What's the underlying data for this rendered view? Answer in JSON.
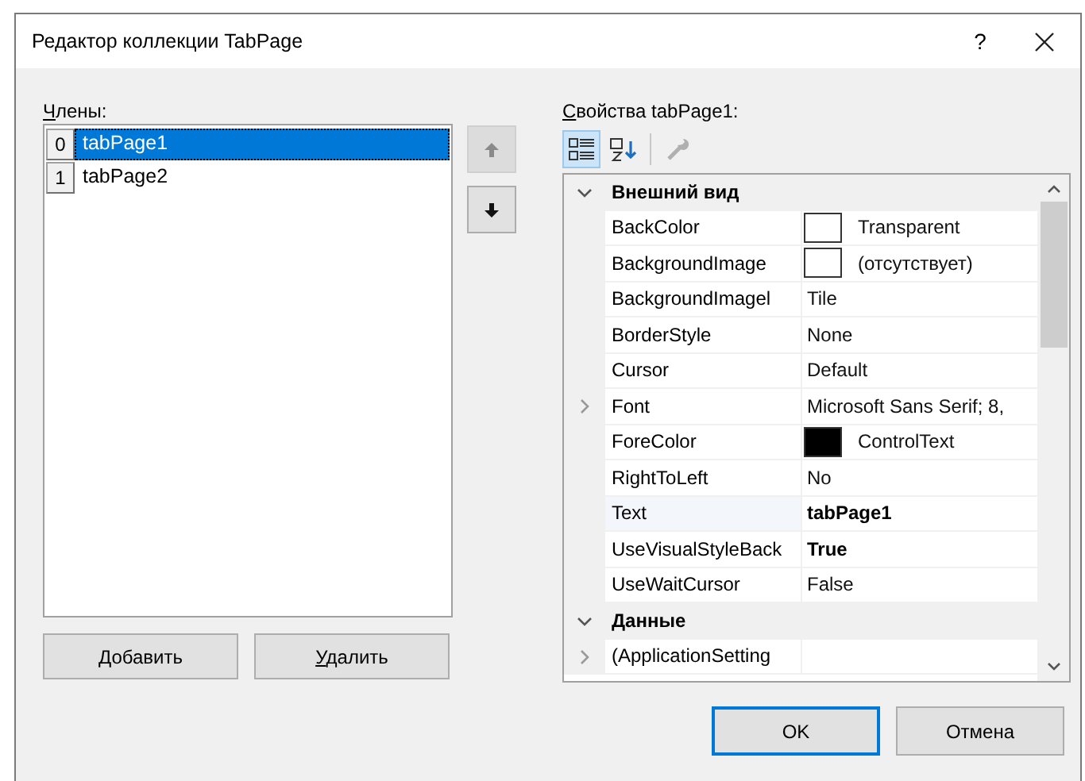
{
  "window": {
    "title": "Редактор коллекции TabPage",
    "help": "?"
  },
  "members": {
    "label": "Члены:",
    "items": [
      {
        "index": "0",
        "name": "tabPage1",
        "selected": true
      },
      {
        "index": "1",
        "name": "tabPage2",
        "selected": false
      }
    ]
  },
  "buttons_left": [
    "Добавить",
    "Удалить"
  ],
  "properties": {
    "label": "Свойства tabPage1:",
    "toolbar": [
      {
        "kind": "categorized",
        "selected": true,
        "disabled": false
      },
      {
        "kind": "alphabetical",
        "selected": false,
        "disabled": false
      },
      {
        "kind": "pages",
        "selected": false,
        "disabled": true
      }
    ],
    "groups": [
      {
        "name": "Внешний вид",
        "expanded": true,
        "rows": [
          {
            "name": "BackColor",
            "value": "Transparent",
            "color": "#ffffff",
            "expanded": null,
            "modified": false,
            "selected": false
          },
          {
            "name": "BackgroundImage",
            "value": "(отсутствует)",
            "color": "#ffffff",
            "expanded": null,
            "modified": false,
            "selected": false
          },
          {
            "name": "BackgroundImagel",
            "value": "Tile",
            "expanded": null,
            "modified": false,
            "selected": false
          },
          {
            "name": "BorderStyle",
            "value": "None",
            "expanded": null,
            "modified": false,
            "selected": false
          },
          {
            "name": "Cursor",
            "value": "Default",
            "expanded": null,
            "modified": false,
            "selected": false
          },
          {
            "name": "Font",
            "value": "Microsoft Sans Serif; 8,",
            "expanded": false,
            "modified": false,
            "selected": false
          },
          {
            "name": "ForeColor",
            "value": "ControlText",
            "color": "#000000",
            "expanded": null,
            "modified": false,
            "selected": false
          },
          {
            "name": "RightToLeft",
            "value": "No",
            "expanded": null,
            "modified": false,
            "selected": false
          },
          {
            "name": "Text",
            "value": "tabPage1",
            "expanded": null,
            "modified": true,
            "selected": true
          },
          {
            "name": "UseVisualStyleBack",
            "value": "True",
            "expanded": null,
            "modified": true,
            "selected": false
          },
          {
            "name": "UseWaitCursor",
            "value": "False",
            "expanded": null,
            "modified": false,
            "selected": false
          }
        ]
      },
      {
        "name": "Данные",
        "expanded": true,
        "rows": [
          {
            "name": "(ApplicationSetting",
            "expanded": false,
            "selected": false
          }
        ]
      }
    ]
  },
  "dialog_buttons": [
    {
      "label": "OK",
      "default": true
    },
    {
      "label": "Отмена",
      "default": false
    }
  ]
}
